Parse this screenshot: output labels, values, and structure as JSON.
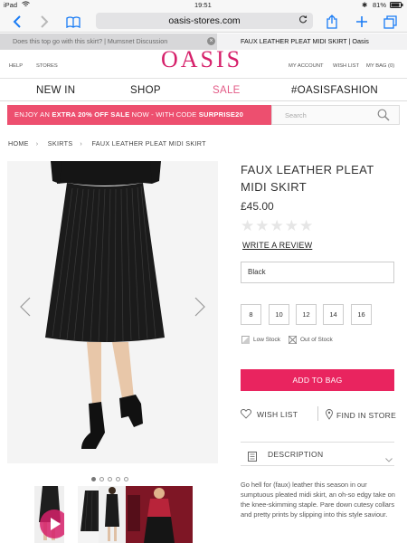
{
  "status_bar": {
    "device": "iPad",
    "time": "19:51",
    "battery": "81%"
  },
  "browser": {
    "url": "oasis-stores.com",
    "tabs": [
      {
        "title": "Does this top go with this skirt? | Mumsnet Discussion"
      },
      {
        "title": "FAUX LEATHER PLEAT MIDI SKIRT | Oasis"
      }
    ]
  },
  "site_header": {
    "logo": "OASIS",
    "help_label": "HELP",
    "stores_label": "STORES",
    "account_label": "MY ACCOUNT",
    "wishlist_label": "WISH LIST",
    "bag_label": "MY BAG (0)"
  },
  "nav": {
    "items": [
      {
        "label": "NEW IN"
      },
      {
        "label": "SHOP"
      },
      {
        "label": "SALE"
      },
      {
        "label": "#OASISFASHION"
      }
    ]
  },
  "promo": {
    "prefix": "ENJOY AN ",
    "highlight": "EXTRA 20% OFF SALE",
    "middle": " NOW - WITH CODE ",
    "code": "SURPRISE20"
  },
  "search": {
    "placeholder": "Search"
  },
  "breadcrumb": [
    "HOME",
    "SKIRTS",
    "FAUX LEATHER PLEAT MIDI SKIRT"
  ],
  "product": {
    "title": "FAUX LEATHER PLEAT MIDI SKIRT",
    "price": "£45.00",
    "rating_stars": 0,
    "write_review": "WRITE A REVIEW",
    "colour": "Black",
    "sizes": [
      "8",
      "10",
      "12",
      "14",
      "16"
    ],
    "low_stock_label": "Low Stock",
    "out_of_stock_label": "Out of Stock",
    "add_to_bag": "ADD TO BAG",
    "wishlist": "WISH LIST",
    "find_in_store": "FIND IN STORE",
    "description_label": "DESCRIPTION",
    "description": "Go hell for (faux) leather this season in our sumptuous pleated midi skirt, an oh-so edgy take on the knee-skimming staple. Pare down cutesy collars and pretty prints by slipping into this style saviour."
  },
  "gallery": {
    "image_count": 5,
    "active_image": 1
  },
  "colors": {
    "brand_pink": "#d6206a",
    "sale_pink": "#e35a86",
    "promo_bg": "#ed4f6f",
    "button_bg": "#e9245f"
  }
}
